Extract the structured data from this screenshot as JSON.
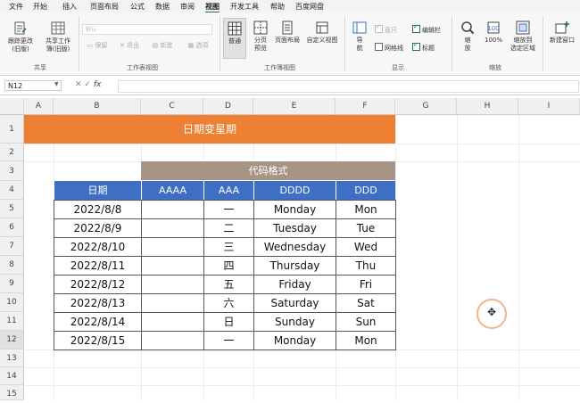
{
  "menu": [
    "文件",
    "开始",
    "插入",
    "页面布局",
    "公式",
    "数据",
    "审阅",
    "视图",
    "开发工具",
    "帮助",
    "百度网盘"
  ],
  "menu_active": "视图",
  "ribbon": {
    "share": {
      "buttons": [
        "跟踪更改\n(旧版)",
        "共享工作\n簿(旧版)"
      ],
      "label": "共享"
    },
    "sheet_view": {
      "combo": "默认",
      "buttons": [
        "保留",
        "退出",
        "新建",
        "选项"
      ],
      "label": "工作表视图"
    },
    "workbook_view": {
      "buttons": [
        "普通",
        "分页\n预览",
        "页面布局",
        "自定义视图"
      ],
      "label": "工作簿视图"
    },
    "show": {
      "nav_button": "导\n航",
      "checks": [
        {
          "label": "直尺",
          "checked": true,
          "disabled": true
        },
        {
          "label": "编辑栏",
          "checked": true,
          "disabled": false
        },
        {
          "label": "网格线",
          "checked": false,
          "disabled": false
        },
        {
          "label": "标题",
          "checked": true,
          "disabled": false
        }
      ],
      "label": "显示"
    },
    "zoom": {
      "buttons": [
        "缩\n放",
        "100%",
        "缩放到\n选定区域"
      ],
      "label": "缩放"
    },
    "window": {
      "buttons": [
        "新建窗口"
      ]
    }
  },
  "formula_bar": {
    "name_box": "N12",
    "fx": "fx",
    "content": ""
  },
  "columns": [
    "A",
    "B",
    "C",
    "D",
    "E",
    "F",
    "G",
    "H",
    "I"
  ],
  "rows": [
    "1",
    "2",
    "3",
    "4",
    "5",
    "6",
    "7",
    "8",
    "9",
    "10",
    "11",
    "12",
    "13",
    "14",
    "15"
  ],
  "sheet": {
    "title": "日期变星期",
    "code_header": "代码格式",
    "headers": [
      "日期",
      "AAAA",
      "AAA",
      "DDDD",
      "DDD"
    ],
    "data": [
      [
        "2022/8/8",
        "",
        "一",
        "Monday",
        "Mon"
      ],
      [
        "2022/8/9",
        "",
        "二",
        "Tuesday",
        "Tue"
      ],
      [
        "2022/8/10",
        "",
        "三",
        "Wednesday",
        "Wed"
      ],
      [
        "2022/8/11",
        "",
        "四",
        "Thursday",
        "Thu"
      ],
      [
        "2022/8/12",
        "",
        "五",
        "Friday",
        "Fri"
      ],
      [
        "2022/8/13",
        "",
        "六",
        "Saturday",
        "Sat"
      ],
      [
        "2022/8/14",
        "",
        "日",
        "Sunday",
        "Sun"
      ],
      [
        "2022/8/15",
        "",
        "一",
        "Monday",
        "Mon"
      ]
    ]
  },
  "colors": {
    "title_band": "#ee8033",
    "code_band": "#a69585",
    "header_blue": "#3e6fc5",
    "accent": "#217346"
  }
}
